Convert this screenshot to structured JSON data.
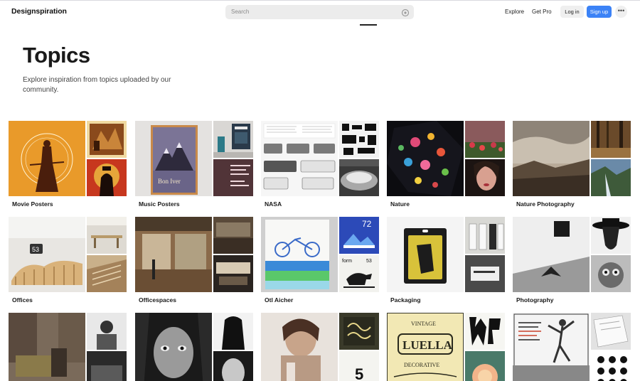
{
  "header": {
    "logo": "Designspiration",
    "search_placeholder": "Search",
    "nav_explore": "Explore",
    "nav_get_pro": "Get Pro",
    "login_label": "Log in",
    "signup_label": "Sign up",
    "more_label": "•••"
  },
  "page": {
    "title": "Topics",
    "description": "Explore inspiration from topics uploaded by our community."
  },
  "topics": [
    {
      "label": "Movie Posters"
    },
    {
      "label": "Music Posters"
    },
    {
      "label": "NASA"
    },
    {
      "label": "Nature"
    },
    {
      "label": "Nature Photography"
    },
    {
      "label": "Offices"
    },
    {
      "label": "Officespaces"
    },
    {
      "label": "Otl Aicher"
    },
    {
      "label": "Packaging"
    },
    {
      "label": "Photography"
    },
    {
      "label": ""
    },
    {
      "label": ""
    },
    {
      "label": ""
    },
    {
      "label": ""
    },
    {
      "label": ""
    }
  ],
  "thumb_text": {
    "bon_iver": "Bon Iver",
    "vintage": "VINTAGE",
    "luella": "LUELLA",
    "decorative": "DECORATIVE",
    "form": "form",
    "form_num": "53",
    "otl_num": "72",
    "five": "5",
    "office_num": "53"
  },
  "colors": {
    "accent": "#3b82f6",
    "search_bg": "#ececec",
    "movie_orange": "#e99a2a"
  }
}
